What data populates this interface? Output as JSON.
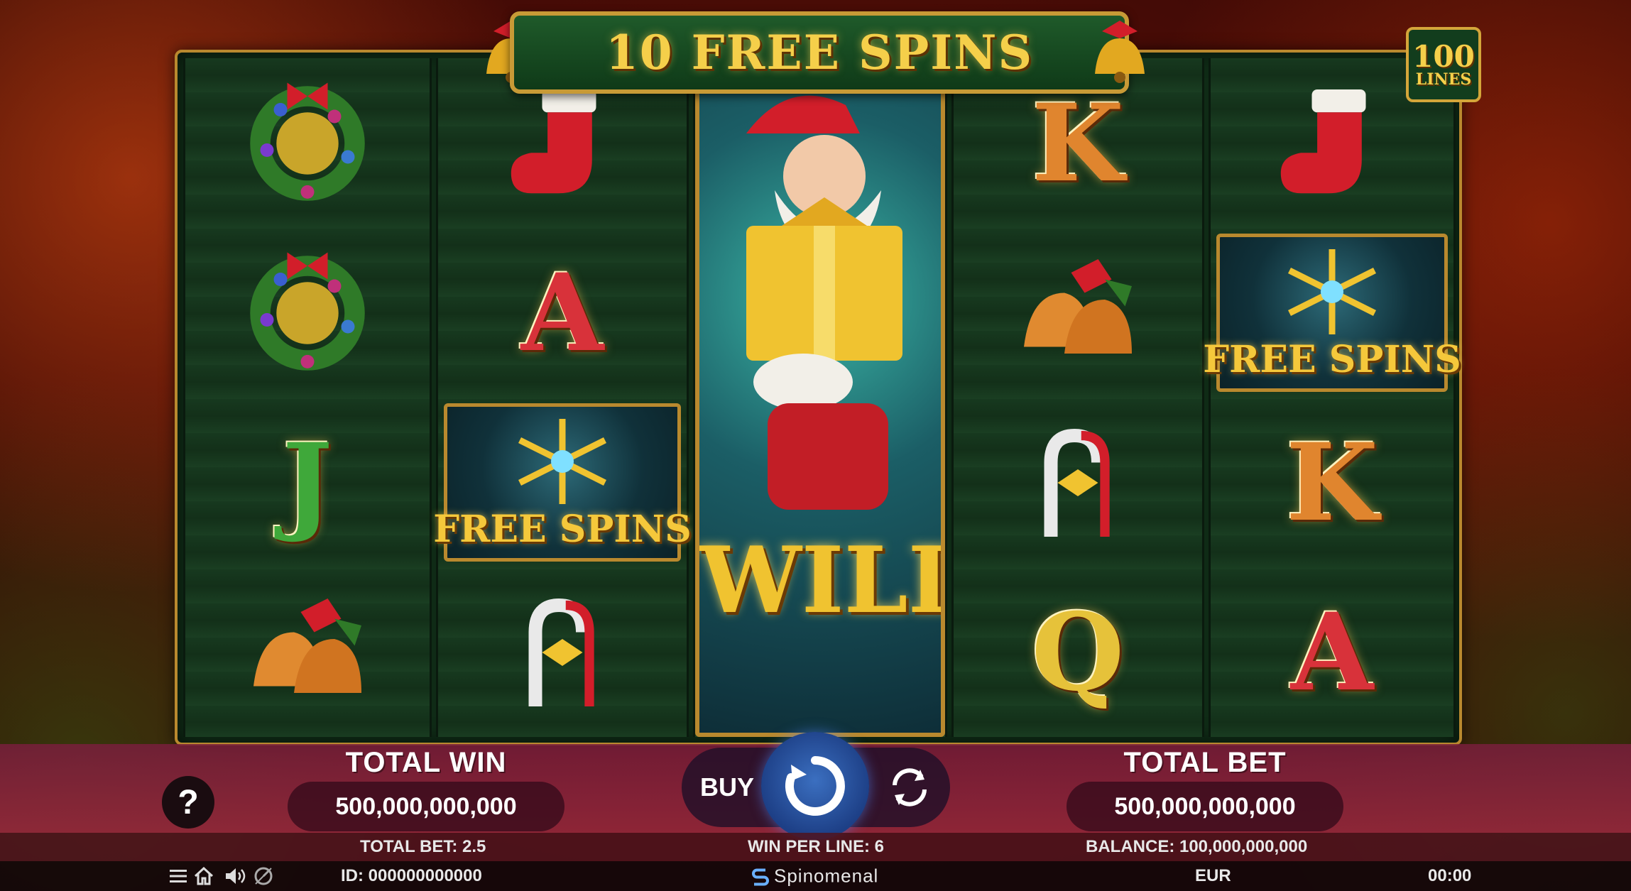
{
  "game": {
    "banner": "10 FREE SPINS",
    "lines_number": "100",
    "lines_word": "LINES",
    "wild_label": "WILD",
    "free_spins_label": "FREE SPINS"
  },
  "reels": [
    [
      "wreath",
      "wreath",
      "J",
      "bells"
    ],
    [
      "stocking",
      "A",
      "free-spins",
      "candy-cane"
    ],
    [
      "wild-santa"
    ],
    [
      "K",
      "bells",
      "candy-cane",
      "Q"
    ],
    [
      "stocking",
      "free-spins",
      "K",
      "A"
    ]
  ],
  "panel": {
    "total_win_title": "TOTAL WIN",
    "total_win_value": "500,000,000,000",
    "total_bet_title": "TOTAL BET",
    "total_bet_value": "500,000,000,000",
    "buy_label": "BUY",
    "help_label": "?"
  },
  "info": {
    "total_bet": "TOTAL BET: 2.5",
    "win_per_line": "WIN PER LINE: 6",
    "balance": "BALANCE: 100,000,000,000"
  },
  "status": {
    "id": "ID: 000000000000",
    "provider": "Spinomenal",
    "currency": "EUR",
    "clock": "00:00"
  },
  "icons": [
    "menu-icon",
    "home-icon",
    "sound-icon",
    "turbo-icon",
    "help-icon",
    "spin-icon",
    "autoplay-icon",
    "spinomenal-logo-icon"
  ],
  "colors": {
    "gold": "#f5cf4a",
    "frame": "#b9892e",
    "spin": "#2a56a8"
  }
}
